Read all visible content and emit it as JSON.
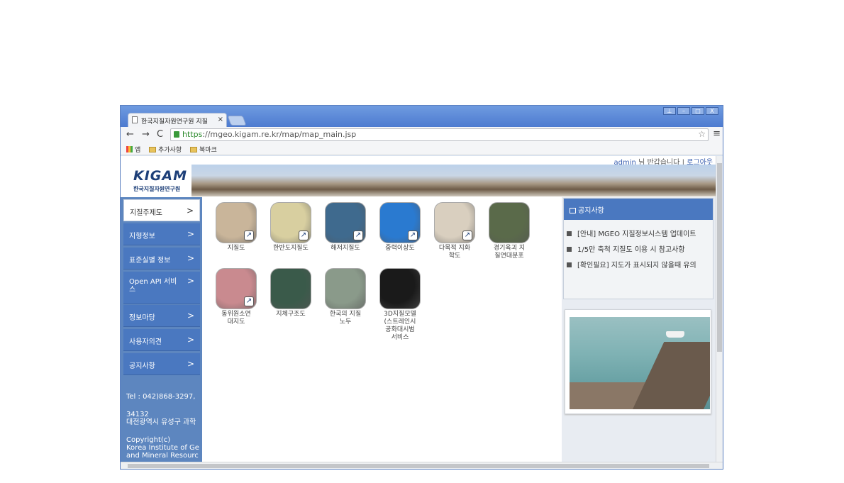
{
  "browser": {
    "tab_title": "한국지질자원연구원 지질",
    "tab_close": "×",
    "url_https": "https",
    "url_rest": "://mgeo.kigam.re.kr/map/map_main.jsp",
    "bookmarks": [
      "앱",
      "추가사항",
      "북마크"
    ],
    "nav": {
      "back": "←",
      "forward": "→",
      "reload": "C"
    },
    "star": "☆",
    "menu": "≡",
    "window_buttons": [
      "⊥",
      "–",
      "□",
      "X"
    ]
  },
  "header": {
    "user": "admin",
    "greeting": "님 반갑습니다 |",
    "logout": "로그아웃",
    "logo_text": "KIGAM",
    "logo_sub": "한국지질자원연구원"
  },
  "sidebar": {
    "items": [
      {
        "label": "지질주제도",
        "chev": ">"
      },
      {
        "label": "지형정보",
        "chev": ">"
      },
      {
        "label": "표준실별 정보",
        "chev": ">"
      },
      {
        "label": "Open API 서비스",
        "chev": ">"
      },
      {
        "label": "정보마당",
        "chev": ">"
      },
      {
        "label": "사용자의견",
        "chev": ">"
      },
      {
        "label": "공지사항",
        "chev": ">"
      }
    ],
    "footer": {
      "tel": "Tel : 042)868-3297,",
      "addr1": "34132",
      "addr2": "대전광역시 유성구 과학",
      "copy1": "Copyright(c)",
      "copy2": "Korea Institute of Ge",
      "copy3": "and Mineral Resourc"
    }
  },
  "tiles": [
    {
      "label1": "지질도",
      "label2": "",
      "label3": "",
      "label4": "",
      "color": "#c9b59a",
      "ext": "↗"
    },
    {
      "label1": "한반도지질도",
      "label2": "",
      "label3": "",
      "label4": "",
      "color": "#d8cfa0",
      "ext": "↗"
    },
    {
      "label1": "해저지질도",
      "label2": "",
      "label3": "",
      "label4": "",
      "color": "#3f6a8e",
      "ext": "↗"
    },
    {
      "label1": "중력이상도",
      "label2": "",
      "label3": "",
      "label4": "",
      "color": "#2a7ad0",
      "ext": "↗"
    },
    {
      "label1": "다목적 지화",
      "label2": "학도",
      "label3": "",
      "label4": "",
      "color": "#d9cfbf",
      "ext": "↗"
    },
    {
      "label1": "경기육괴 지",
      "label2": "질연대분포",
      "label3": "",
      "label4": "",
      "color": "#5a6a4a",
      "ext": ""
    },
    {
      "label1": "동위원소연",
      "label2": "대지도",
      "label3": "",
      "label4": "",
      "color": "#c98a8f",
      "ext": "↗"
    },
    {
      "label1": "지체구조도",
      "label2": "",
      "label3": "",
      "label4": "",
      "color": "#3a5a4a",
      "ext": ""
    },
    {
      "label1": "한국의 지질",
      "label2": "노두",
      "label3": "",
      "label4": "",
      "color": "#8a9a8a",
      "ext": ""
    },
    {
      "label1": "3D지질모델",
      "label2": "(스트레인시",
      "label3": "공화대시범",
      "label4": "서비스",
      "color": "#1a1a1a",
      "ext": ""
    }
  ],
  "notice": {
    "title": "공지사항",
    "items": [
      "[안내] MGEO 지질정보시스템 업데이트",
      "1/5만 축척 지질도 이용 시 참고사항",
      "[확인필요] 지도가 표시되지 않을때 유의"
    ]
  }
}
